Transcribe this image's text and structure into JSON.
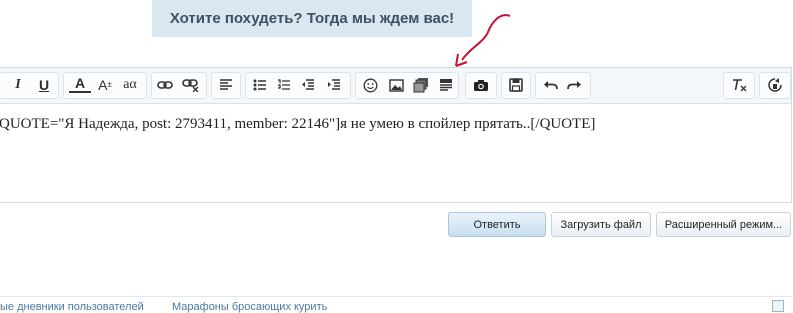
{
  "banner": {
    "text": "Хотите похудеть? Тогда мы ждем вас!"
  },
  "toolbar": {
    "groups": [
      {
        "icons": [
          "italic-icon",
          "underline-icon"
        ]
      },
      {
        "icons": [
          "font-color-icon",
          "font-size-icon",
          "font-family-icon"
        ]
      },
      {
        "icons": [
          "link-icon",
          "unlink-icon"
        ]
      },
      {
        "icons": [
          "align-left-icon"
        ]
      },
      {
        "icons": [
          "bullet-list-icon",
          "numbered-list-icon",
          "outdent-icon",
          "indent-icon"
        ]
      },
      {
        "icons": [
          "smiley-icon",
          "image-icon",
          "media-icon",
          "spoiler-icon"
        ]
      },
      {
        "icons": [
          "camera-icon"
        ]
      },
      {
        "icons": [
          "save-icon"
        ]
      },
      {
        "icons": [
          "undo-icon",
          "redo-icon"
        ]
      },
      {
        "icons": [
          "remove-format-icon"
        ]
      },
      {
        "icons": [
          "toggle-mode-icon"
        ]
      }
    ],
    "italic_label": "I",
    "underline_label": "U",
    "font_color_label": "A",
    "font_size_label": "A",
    "font_size_sup": "±",
    "font_family_label": "aα"
  },
  "editor": {
    "content": "QUOTE=\"Я Надежда, post: 2793411, member: 22146\"]я не умею в спойлер прятать..[/QUOTE]"
  },
  "actions": {
    "reply": "Ответить",
    "upload": "Загрузить файл",
    "advanced": "Расширенный режим..."
  },
  "footer": {
    "link1": "ые дневники пользователей",
    "link2": "Марафоны бросающих курить"
  },
  "colors": {
    "accent": "#c8102e",
    "banner_bg": "#d9e7f1"
  }
}
